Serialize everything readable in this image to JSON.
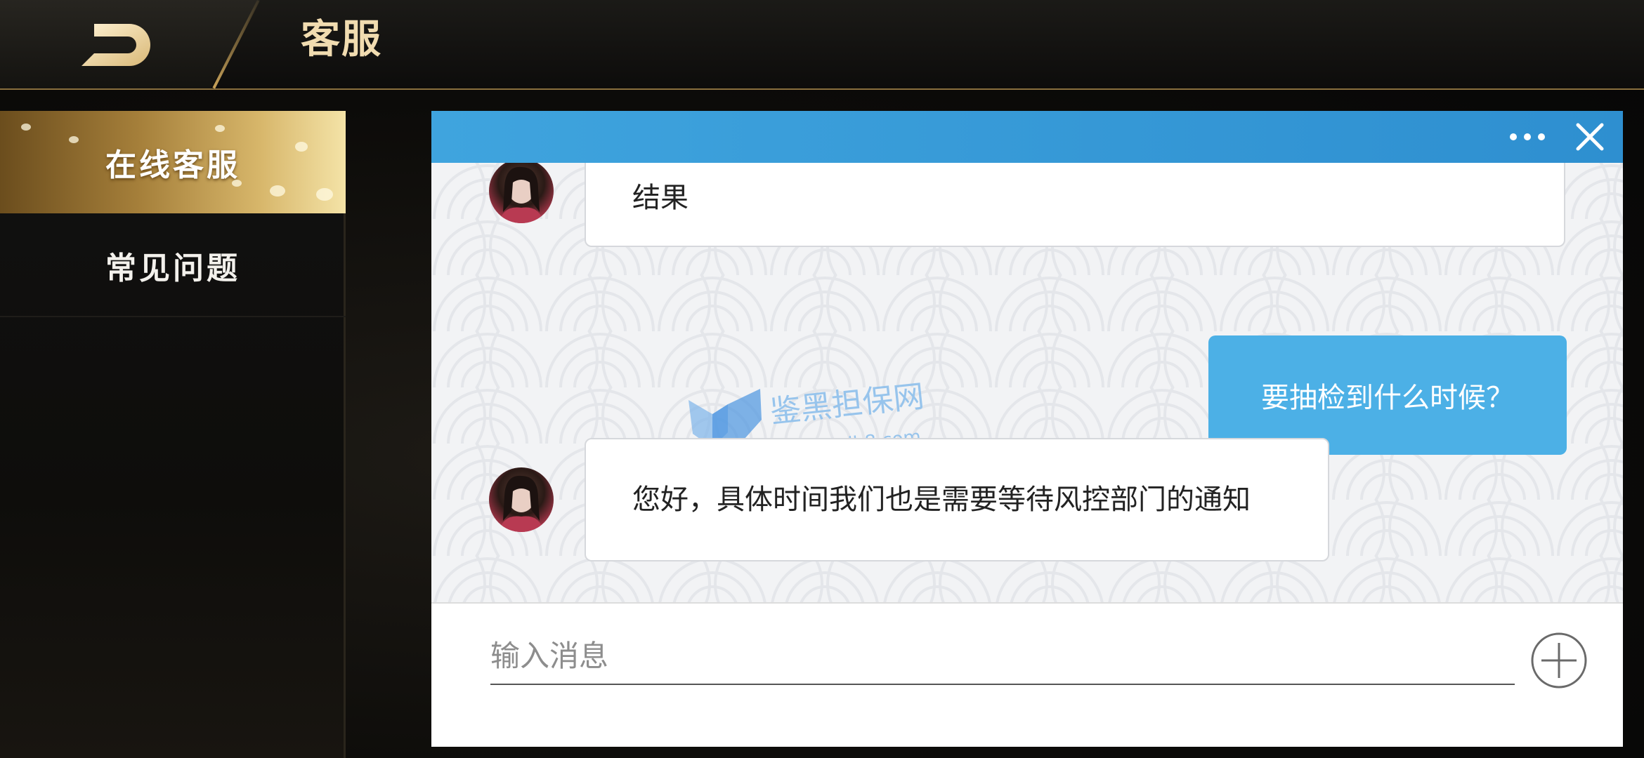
{
  "header": {
    "title": "客服",
    "back_icon": "back-arrow-icon"
  },
  "sidebar": {
    "items": [
      {
        "label": "在线客服",
        "active": true
      },
      {
        "label": "常见问题",
        "active": false
      }
    ]
  },
  "chat": {
    "header_icons": [
      "more-dots-icon",
      "close-icon"
    ],
    "messages": [
      {
        "sender": "agent",
        "text": "结果"
      },
      {
        "sender": "user",
        "text": "要抽检到什么时候？"
      },
      {
        "sender": "agent",
        "text": "您好，具体时间我们也是需要等待风控部门的通知"
      }
    ],
    "watermark": {
      "name": "鉴黑担保网",
      "url": "www.jhdb8.com"
    },
    "input": {
      "placeholder": "输入消息",
      "value": ""
    },
    "add_icon": "plus-circle-icon"
  },
  "colors": {
    "accent_gold": "#f1dcb0",
    "chat_header_blue": "#3fa4de",
    "user_bubble_blue": "#4cb0e6"
  }
}
